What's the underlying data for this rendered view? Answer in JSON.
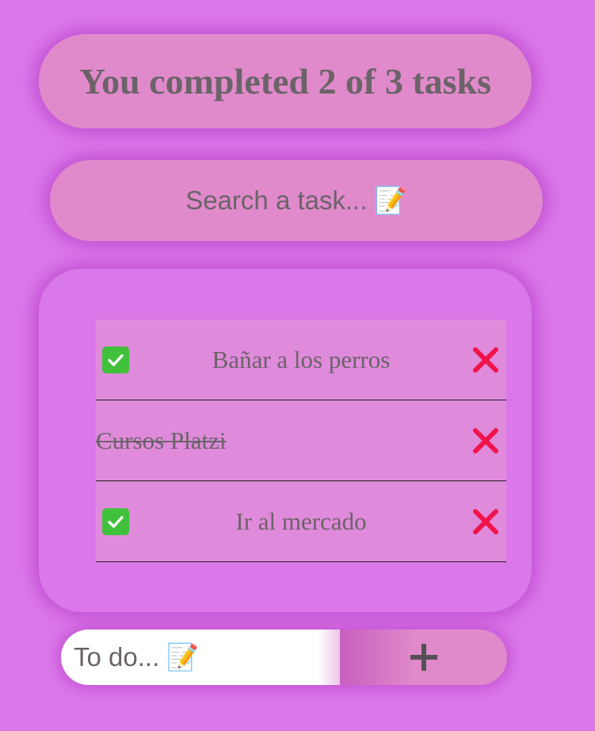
{
  "counter": {
    "text": "You completed 2 of 3 tasks",
    "completed": 2,
    "total": 3
  },
  "search": {
    "placeholder": "Search a task... 📝"
  },
  "todos": [
    {
      "text": "Bañar a los perros",
      "completed": false,
      "check_icon": "check-mark-button-icon",
      "delete_icon": "cross-mark-icon"
    },
    {
      "text": "Cursos Platzi",
      "completed": true,
      "delete_icon": "cross-mark-icon"
    },
    {
      "text": "Ir al mercado",
      "completed": false,
      "check_icon": "check-mark-button-icon",
      "delete_icon": "cross-mark-icon"
    }
  ],
  "new_todo": {
    "placeholder": "To do... 📝",
    "value": ""
  },
  "add_button": {
    "icon": "plus-icon"
  },
  "colors": {
    "background": "#db78e9",
    "card": "#e08acb",
    "text": "#6b6368",
    "check": "#41c13b",
    "delete": "#f0144a"
  }
}
